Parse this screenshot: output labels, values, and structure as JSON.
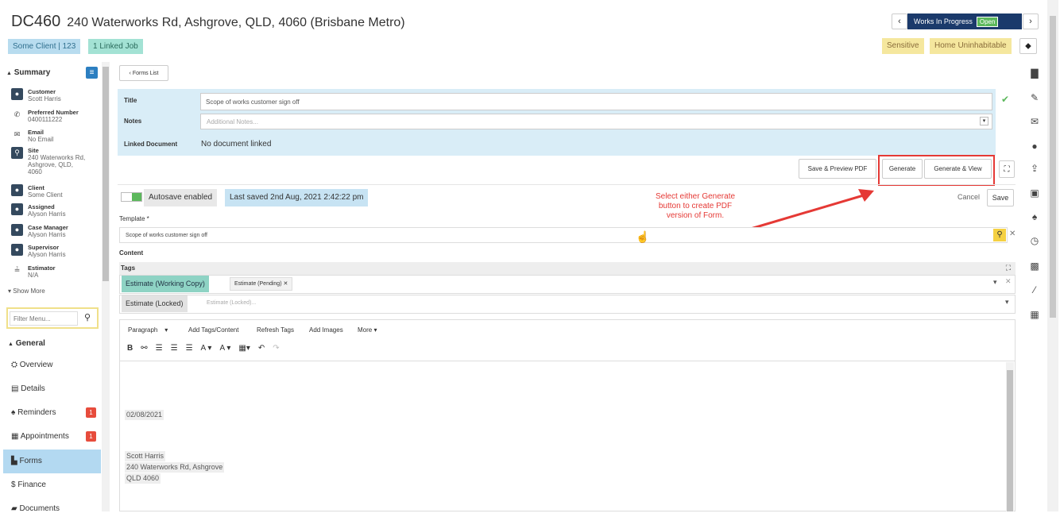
{
  "header": {
    "job_number": "DC460",
    "address": "240 Waterworks Rd, Ashgrove, QLD, 4060 (Brisbane Metro)",
    "client_chip": "Some Client | 123",
    "linked_chip": "1 Linked Job",
    "status_label": "Works In Progress",
    "status_badge": "Open",
    "tag_sensitive": "Sensitive",
    "tag_uninhabitable": "Home Uninhabitable"
  },
  "summary": {
    "title": "Summary",
    "items": [
      {
        "label": "Customer",
        "value": "Scott Harris"
      },
      {
        "label": "Preferred Number",
        "value": "0400111222"
      },
      {
        "label": "Email",
        "value": "No Email"
      },
      {
        "label": "Site",
        "value": "240 Waterworks Rd,"
      },
      {
        "label": "Client",
        "value": "Some Client"
      },
      {
        "label": "Assigned",
        "value": "Alyson Harris"
      },
      {
        "label": "Case Manager",
        "value": "Alyson Harris"
      },
      {
        "label": "Supervisor",
        "value": "Alyson Harris"
      },
      {
        "label": "Estimator",
        "value": "N/A"
      }
    ],
    "site_line2": "Ashgrove, QLD,",
    "site_line3": "4060",
    "show_more": "Show More"
  },
  "filter": {
    "placeholder": "Filter Menu..."
  },
  "nav": {
    "section": "General",
    "items": [
      {
        "label": "Overview"
      },
      {
        "label": "Details"
      },
      {
        "label": "Reminders",
        "badge": "1"
      },
      {
        "label": "Appointments",
        "badge": "1"
      },
      {
        "label": "Forms"
      },
      {
        "label": "Finance"
      },
      {
        "label": "Documents"
      }
    ]
  },
  "form": {
    "forms_list_btn": "Forms List",
    "title_label": "Title",
    "title_value": "Scope of works customer sign off",
    "notes_label": "Notes",
    "notes_placeholder": "Additional Notes...",
    "linked_doc_label": "Linked Document",
    "linked_doc_value": "No document linked",
    "btn_save_preview": "Save & Preview PDF",
    "btn_generate": "Generate",
    "btn_generate_view": "Generate & View",
    "autosave": "Autosave enabled",
    "last_saved": "Last saved 2nd Aug, 2021 2:42:22 pm",
    "cancel": "Cancel",
    "save": "Save",
    "template_label": "Template *",
    "template_value": "Scope of works customer sign off",
    "content_label": "Content",
    "tags_label": "Tags",
    "tag_working": "Estimate (Working Copy)",
    "tag_pending": "Estimate (Pending)",
    "tag_locked": "Estimate (Locked)",
    "tag_locked_placeholder": "Estimate (Locked)..."
  },
  "annotation": {
    "line1": "Select either Generate",
    "line2": "button to create PDF",
    "line3": "version of Form."
  },
  "toolbar": {
    "paragraph": "Paragraph",
    "add_tags": "Add Tags/Content",
    "refresh": "Refresh Tags",
    "add_images": "Add Images",
    "more": "More"
  },
  "editor": {
    "date": "02/08/2021",
    "name": "Scott Harris",
    "street": "240 Waterworks Rd, Ashgrove",
    "state": "QLD 4060"
  },
  "colors": {
    "accent_blue": "#d9edf7",
    "status_navy": "#1b3a6b",
    "open_green": "#5cb85c",
    "tag_yellow": "#f5e79e",
    "active_nav": "#b3d9f1",
    "annotation_red": "#e53935"
  }
}
